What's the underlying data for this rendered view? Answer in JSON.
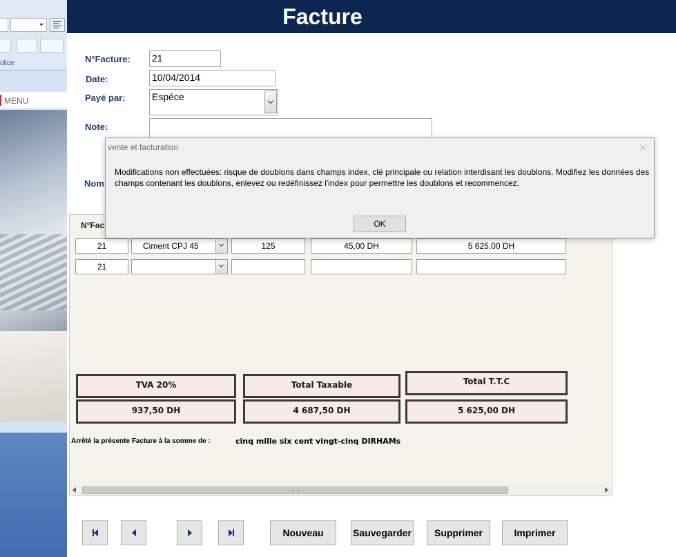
{
  "background_app": {
    "ribbon_group_label": "olice",
    "menu_label": "MENU"
  },
  "form": {
    "title": "Facture",
    "fields": {
      "num_facture_label": "N°Facture:",
      "num_facture_value": "21",
      "date_label": "Date:",
      "date_value": "10/04/2014",
      "paye_par_label": "Payé par:",
      "paye_par_value": "Espéce",
      "note_label": "Note:",
      "note_value": "",
      "nom_label_partial": "Nom"
    },
    "subform": {
      "header_partial": "N°Fac",
      "rows": [
        {
          "num": "21",
          "produit": "Ciment CPJ 45",
          "quantite": "125",
          "prix": "45,00 DH",
          "total": "5 625,00 DH"
        },
        {
          "num": "21",
          "produit": "",
          "quantite": "",
          "prix": "",
          "total": ""
        }
      ],
      "totals": {
        "tva_label": "TVA 20%",
        "tva_value": "937,50 DH",
        "taxable_label": "Total Taxable",
        "taxable_value": "4 687,50 DH",
        "ttc_label": "Total T.T.C",
        "ttc_value": "5 625,00 DH"
      },
      "arrete_label": "Arrêté la présente Facture à la somme de :",
      "arrete_value": "cinq mille six cent vingt-cinq DIRHAMs"
    },
    "buttons": {
      "nouveau": "Nouveau",
      "sauvegarder": "Sauvegarder",
      "supprimer": "Supprimer",
      "imprimer": "Imprimer"
    }
  },
  "dialog": {
    "title": "vente et facturation",
    "message": "Modifications non effectuées: risque de doublons dans champs index, clé principale ou relation interdisant les doublons. Modifiez les données des champs contenant les doublons, enlevez ou redéfinissez l'index pour permettre les doublons et recommencez.",
    "ok_label": "OK"
  }
}
